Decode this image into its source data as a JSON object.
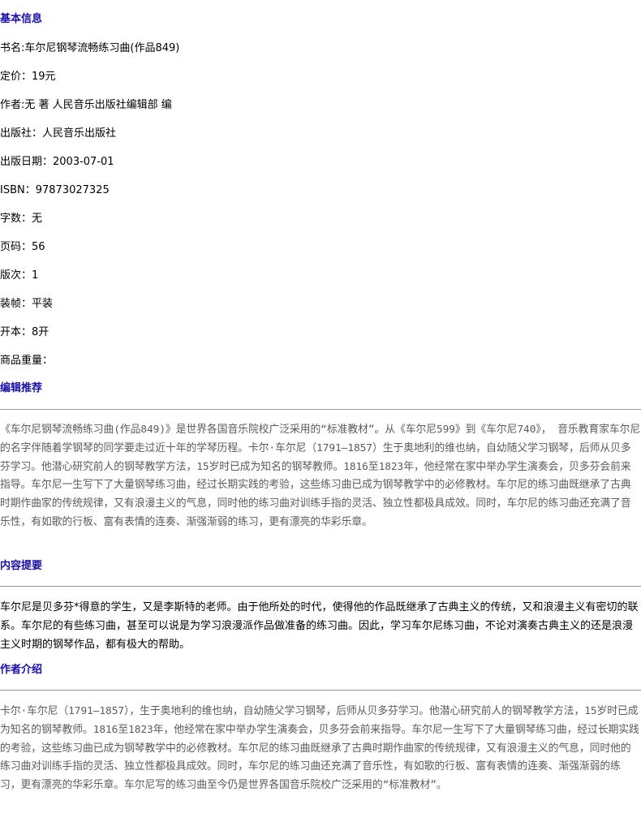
{
  "basic_info": {
    "heading": "基本信息",
    "fields": [
      "书名:车尔尼钢琴流畅练习曲(作品849)",
      "定价：19元",
      "作者:无 著 人民音乐出版社编辑部 编",
      "出版社：人民音乐出版社",
      "出版日期：2003-07-01",
      "ISBN：97873027325",
      "字数：无",
      "页码：56",
      "版次：1",
      "装帧：平装",
      "开本：8开",
      "商品重量："
    ]
  },
  "editor_recommend": {
    "heading": "编辑推荐",
    "text": "《车尔尼钢琴流畅练习曲(作品849)》是世界各国音乐院校广泛采用的“标准教材”。从《车尔尼599》到《车尔尼740》， 音乐教育家车尔尼的名字伴随着学钢琴的同学要走过近十年的学琴历程。卡尔·车尔尼（1791—1857）生于奥地利的维也纳，自幼随父学习钢琴，后师从贝多芬学习。他潜心研究前人的钢琴教学方法，15岁时已成为知名的钢琴教师。1816至1823年，他经常在家中举办学生演奏会，贝多芬会前来指导。车尔尼一生写下了大量钢琴练习曲，经过长期实践的考验，这些练习曲已成为钢琴教学中的必修教材。车尔尼的练习曲既继承了古典时期作曲家的传统规律，又有浪漫主义的气息，同时他的练习曲对训练手指的灵活、独立性都极具成效。同时，车尔尼的练习曲还充满了音乐性，有如歌的行板、富有表情的连奏、渐强渐弱的练习，更有漂亮的华彩乐章。"
  },
  "summary": {
    "heading": "内容提要",
    "text": "车尔尼是贝多芬*得意的学生，又是李斯特的老师。由于他所处的时代，使得他的作品既继承了古典主义的传统，又和浪漫主义有密切的联系。车尔尼的有些练习曲，甚至可以说是为学习浪漫派作品做准备的练习曲。因此，学习车尔尼练习曲，不论对演奏古典主义的还是浪漫主义时期的钢琴作品，都有极大的帮助。"
  },
  "author_intro": {
    "heading": "作者介绍",
    "text": "卡尔·车尔尼（1791—1857），生于奥地利的维也纳，自幼随父学习钢琴，后师从贝多芬学习。他潜心研究前人的钢琴教学方法，15岁时已成为知名的钢琴教师。1816至1823年，他经常在家中举办学生演奏会，贝多芬会前来指导。车尔尼一生写下了大量钢琴练习曲，经过长期实践的考验，这些练习曲已成为钢琴教学中的必修教材。车尔尼的练习曲既继承了古典时期作曲家的传统规律，又有浪漫主义的气息，同时他的练习曲对训练手指的灵活、独立性都极具成效。同时，车尔尼的练习曲还充满了音乐性，有如歌的行板、富有表情的连奏、渐强渐弱的练习，更有漂亮的华彩乐章。车尔尼写的练习曲至今仍是世界各国音乐院校广泛采用的“标准教材”。"
  }
}
